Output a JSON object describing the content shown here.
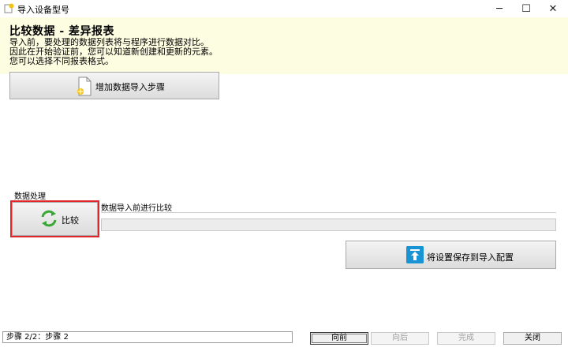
{
  "window": {
    "title": "导入设备型号",
    "minimize_symbol": "─",
    "maximize_symbol": "☐",
    "close_symbol": "✕"
  },
  "header": {
    "heading": "比较数据 - 差异报表",
    "lines": [
      "导入前，要处理的数据列表将与程序进行数据对比。",
      "因此在开始验证前，您可以知道新创建和更新的元素。",
      "您可以选择不同报表格式。"
    ]
  },
  "add_step_button": {
    "label": "增加数据导入步骤",
    "icon": "document-add-icon"
  },
  "data_processing": {
    "section_label": "数据处理",
    "compare_button": {
      "label": "比较",
      "icon": "refresh-arrows-icon",
      "icon_color": "#3aa635"
    },
    "status_text": "数据导入前进行比较"
  },
  "save_config_button": {
    "label": "将设置保存到导入配置",
    "icon": "upload-icon",
    "icon_color": "#1893d4"
  },
  "statusbar": {
    "text": "步骤 2/2：步骤 2"
  },
  "nav": {
    "prev": "向前",
    "next": "向后",
    "finish": "完成",
    "close": "关闭"
  },
  "colors": {
    "header_bg": "#fdfde2",
    "highlight": "#e0262b"
  }
}
